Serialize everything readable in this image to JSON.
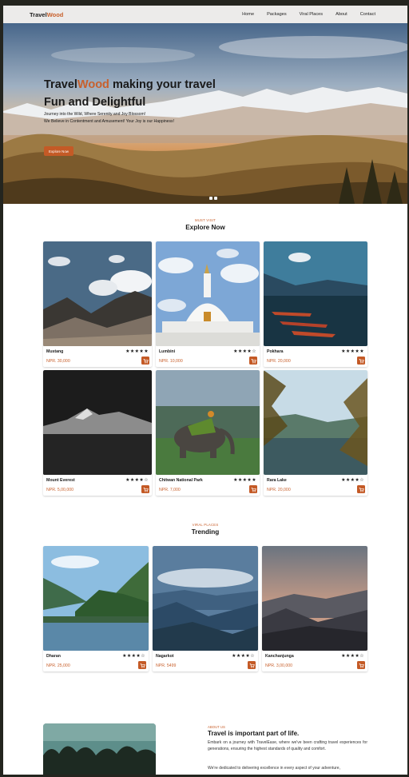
{
  "nav": {
    "logo_main": "Travel",
    "logo_accent": "Wood",
    "links": [
      "Home",
      "Packages",
      "Viral Places",
      "About",
      "Contact"
    ]
  },
  "hero": {
    "title_part1": "Travel",
    "title_accent": "Wood",
    "title_part2": " making your travel Fun and Delightful",
    "subtitle_line1": "Journey into the Wild, Where Serenity and Joy Blossom!",
    "subtitle_line2": "We Believe in Contentment and Amusement! Your Joy is our Happiness!",
    "cta_label": "Explore Now"
  },
  "explore": {
    "eyebrow": "MUST VISIT",
    "title": "Explore Now",
    "cards": [
      {
        "name": "Mustang",
        "rating": 5,
        "stars": "★★★★★",
        "price": "NPR. 30,000"
      },
      {
        "name": "Lumbini",
        "rating": 4.5,
        "stars": "★★★★☆",
        "price": "NPR. 10,000"
      },
      {
        "name": "Pokhara",
        "rating": 5,
        "stars": "★★★★★",
        "price": "NPR. 20,000"
      },
      {
        "name": "Mount Everest",
        "rating": 4.5,
        "stars": "★★★★☆",
        "price": "NPR. 5,00,000"
      },
      {
        "name": "Chitwan National Park",
        "rating": 5,
        "stars": "★★★★★",
        "price": "NPR. 7,000"
      },
      {
        "name": "Rara Lake",
        "rating": 4.5,
        "stars": "★★★★☆",
        "price": "NPR. 20,000"
      }
    ]
  },
  "trending": {
    "eyebrow": "VIRAL PLACES",
    "title": "Trending",
    "cards": [
      {
        "name": "Dharan",
        "rating": 4.5,
        "stars": "★★★★☆",
        "price": "NPR. 25,000"
      },
      {
        "name": "Nagarkot",
        "rating": 4.5,
        "stars": "★★★★☆",
        "price": "NPR. 5499"
      },
      {
        "name": "Kanchanjunga",
        "rating": 4.5,
        "stars": "★★★★☆",
        "price": "NPR. 3,00,000"
      }
    ]
  },
  "about": {
    "eyebrow": "ABOUT US",
    "title": "Travel is important part of life.",
    "paragraph1": "Embark on a journey with TravelEase, where we've been crafting travel experiences for generations, ensuring the highest standards of quality and comfort.",
    "paragraph2": "We're dedicated to delivering excellence in every aspect of your adventure,"
  },
  "colors": {
    "accent": "#c8602c",
    "button": "#c45a26",
    "nav_bg": "#ecebea"
  },
  "icons": {
    "cart": "cart-icon",
    "star": "star-icon"
  }
}
